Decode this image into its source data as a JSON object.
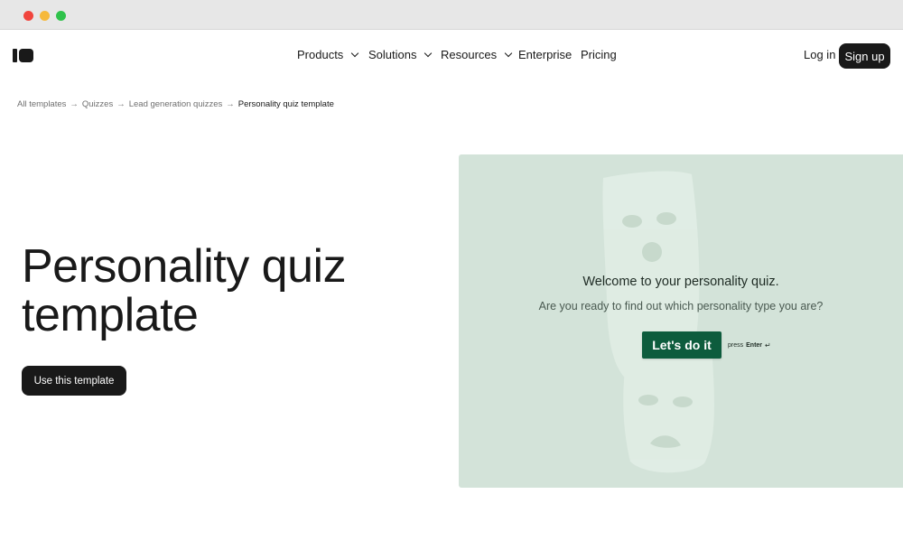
{
  "window": {
    "controls": [
      "close",
      "minimize",
      "maximize"
    ]
  },
  "nav": {
    "logo_icon": "typeform-logo-icon",
    "items": [
      {
        "label": "Products",
        "has_dropdown": true
      },
      {
        "label": "Solutions",
        "has_dropdown": true
      },
      {
        "label": "Resources",
        "has_dropdown": true
      },
      {
        "label": "Enterprise",
        "has_dropdown": false
      },
      {
        "label": "Pricing",
        "has_dropdown": false
      }
    ],
    "login_label": "Log in",
    "signup_label": "Sign up"
  },
  "breadcrumb": {
    "items": [
      "All templates",
      "Quizzes",
      "Lead generation quizzes",
      "Personality quiz template"
    ],
    "separator": "→"
  },
  "hero": {
    "title_line1": "Personality quiz",
    "title_line2": "template",
    "cta_label": "Use this template"
  },
  "preview": {
    "background_color": "#d3e3d9",
    "welcome_text": "Welcome to your personality quiz.",
    "question_text": "Are you ready to find out which personality type you are?",
    "button_label": "Let's do it",
    "button_color": "#0d5c3d",
    "hint_prefix": "press",
    "hint_key": "Enter",
    "hint_icon": "↵",
    "decoration": "theater-masks-icon"
  },
  "colors": {
    "primary_dark": "#191919",
    "muted_text": "#6f6f6f"
  }
}
